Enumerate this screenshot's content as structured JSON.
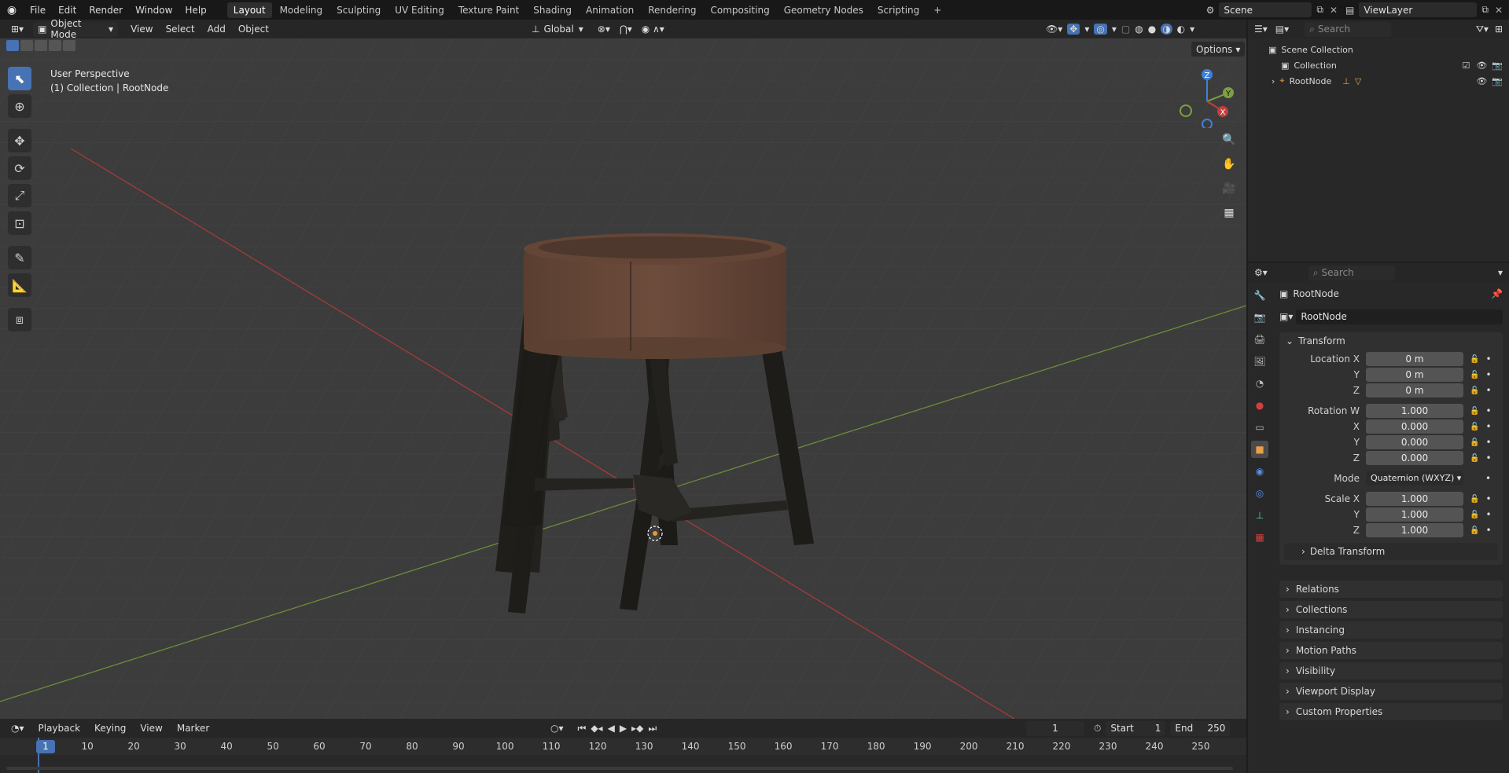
{
  "topbar": {
    "menus": [
      "File",
      "Edit",
      "Render",
      "Window",
      "Help"
    ],
    "workspaces": [
      "Layout",
      "Modeling",
      "Sculpting",
      "UV Editing",
      "Texture Paint",
      "Shading",
      "Animation",
      "Rendering",
      "Compositing",
      "Geometry Nodes",
      "Scripting"
    ],
    "active_workspace": "Layout",
    "add_tab": "+",
    "scene": "Scene",
    "view_layer": "ViewLayer"
  },
  "viewport_header": {
    "mode": "Object Mode",
    "menus": [
      "View",
      "Select",
      "Add",
      "Object"
    ],
    "orientation": "Global",
    "options": "Options"
  },
  "viewport": {
    "perspective": "User Perspective",
    "context": "(1) Collection | RootNode",
    "gizmo": {
      "x": "X",
      "y": "Y",
      "z": "Z"
    }
  },
  "outliner": {
    "search_placeholder": "Search",
    "scene_collection": "Scene Collection",
    "collection": "Collection",
    "root_node": "RootNode"
  },
  "properties": {
    "search_placeholder": "Search",
    "object_name": "RootNode",
    "data_name": "RootNode",
    "transform_label": "Transform",
    "location": {
      "label_x": "Location X",
      "label_y": "Y",
      "label_z": "Z",
      "x": "0 m",
      "y": "0 m",
      "z": "0 m"
    },
    "rotation": {
      "label_w": "Rotation W",
      "label_x": "X",
      "label_y": "Y",
      "label_z": "Z",
      "w": "1.000",
      "x": "0.000",
      "y": "0.000",
      "z": "0.000"
    },
    "mode_label": "Mode",
    "mode_value": "Quaternion (WXYZ)",
    "scale": {
      "label_x": "Scale X",
      "label_y": "Y",
      "label_z": "Z",
      "x": "1.000",
      "y": "1.000",
      "z": "1.000"
    },
    "delta_transform": "Delta Transform",
    "panels": [
      "Relations",
      "Collections",
      "Instancing",
      "Motion Paths",
      "Visibility",
      "Viewport Display",
      "Custom Properties"
    ]
  },
  "timeline": {
    "menus": [
      "Playback",
      "Keying",
      "View",
      "Marker"
    ],
    "current_frame": "1",
    "start_label": "Start",
    "start": "1",
    "end_label": "End",
    "end": "250",
    "ticks": [
      "1",
      "10",
      "20",
      "30",
      "40",
      "50",
      "60",
      "70",
      "80",
      "90",
      "100",
      "110",
      "120",
      "130",
      "140",
      "150",
      "160",
      "170",
      "180",
      "190",
      "200",
      "210",
      "220",
      "230",
      "240",
      "250"
    ]
  },
  "colors": {
    "accent": "#4772b3",
    "x_axis": "#c04040",
    "y_axis": "#7ea040",
    "z_axis": "#3f7fd8"
  }
}
